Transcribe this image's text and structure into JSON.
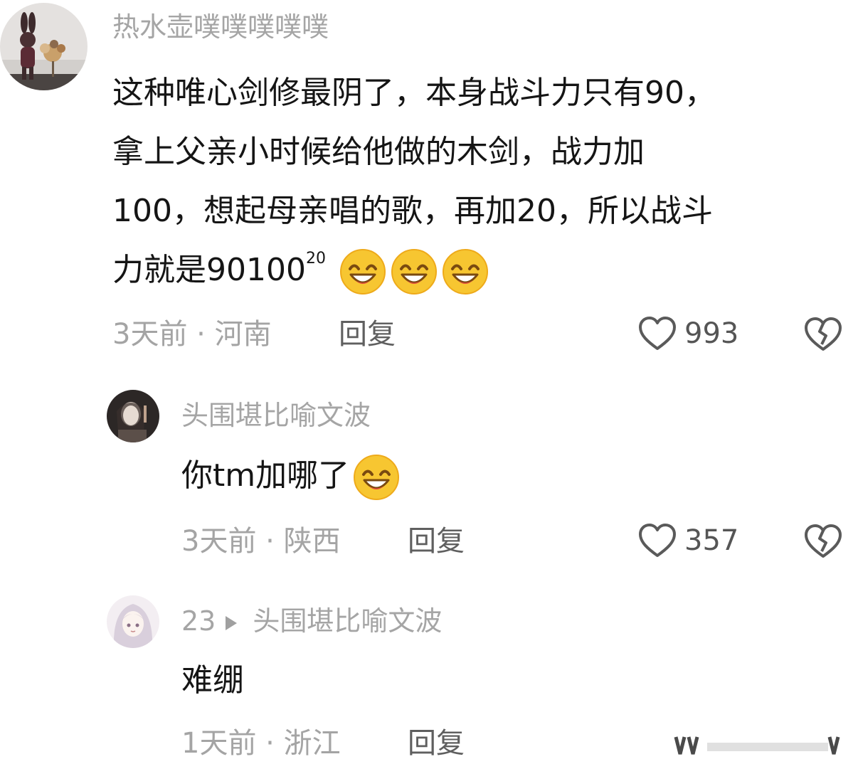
{
  "comments": [
    {
      "username": "热水壶噗噗噗噗噗",
      "lines": [
        "这种唯心剑修最阴了，本身战斗力只有90，",
        "拿上父亲小时候给他做的木剑，战力加",
        "100，想起母亲唱的歌，再加20，所以战斗"
      ],
      "last_line_prefix": "力就是90100",
      "power": "20",
      "emoji_icon": "grinning-emoji",
      "emoji_count": 3,
      "meta": "3天前 · 河南",
      "reply_label": "回复",
      "likes": "993"
    },
    {
      "username": "头围堪比喻文波",
      "text": "你tm加哪了",
      "emoji_icon": "grinning-emoji",
      "emoji_count": 1,
      "meta": "3天前 · 陕西",
      "reply_label": "回复",
      "likes": "357"
    },
    {
      "username": "23",
      "reply_to": "头围堪比喻文波",
      "text": "难绷",
      "meta": "1天前 · 浙江",
      "reply_label": "回复"
    }
  ],
  "icons": {
    "like": "heart-outline-icon",
    "dislike": "broken-heart-icon",
    "reply_arrow": "play-triangle-icon"
  },
  "colors": {
    "username": "#a5a5a5",
    "text": "#151515",
    "meta": "#a4a4a4",
    "emoji": "#f7c631"
  }
}
